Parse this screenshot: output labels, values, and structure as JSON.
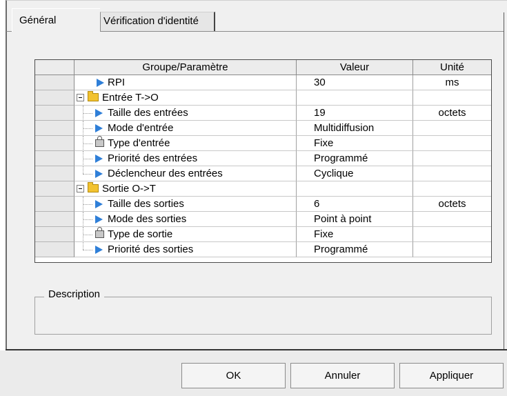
{
  "tabs": {
    "general": "Général",
    "identity": "Vérification d'identité"
  },
  "grid": {
    "headers": {
      "group": "Groupe/Paramètre",
      "value": "Valeur",
      "unit": "Unité"
    },
    "rows": [
      {
        "name": "RPI",
        "value": "30",
        "unit": "ms",
        "icon": "play-icon"
      },
      {
        "name": "Entrée T->O",
        "value": "",
        "unit": "",
        "icon": "folder-icon"
      },
      {
        "name": "Taille des entrées",
        "value": "19",
        "unit": "octets",
        "icon": "play-icon"
      },
      {
        "name": "Mode d'entrée",
        "value": "Multidiffusion",
        "unit": "",
        "icon": "play-icon"
      },
      {
        "name": "Type d'entrée",
        "value": "Fixe",
        "unit": "",
        "icon": "lock-icon"
      },
      {
        "name": "Priorité des entrées",
        "value": "Programmé",
        "unit": "",
        "icon": "play-icon"
      },
      {
        "name": "Déclencheur des entrées",
        "value": "Cyclique",
        "unit": "",
        "icon": "play-icon"
      },
      {
        "name": "Sortie O->T",
        "value": "",
        "unit": "",
        "icon": "folder-icon"
      },
      {
        "name": "Taille des sorties",
        "value": "6",
        "unit": "octets",
        "icon": "play-icon"
      },
      {
        "name": "Mode des sorties",
        "value": "Point à point",
        "unit": "",
        "icon": "play-icon"
      },
      {
        "name": "Type de sortie",
        "value": "Fixe",
        "unit": "",
        "icon": "lock-icon"
      },
      {
        "name": "Priorité des sorties",
        "value": "Programmé",
        "unit": "",
        "icon": "play-icon"
      }
    ]
  },
  "description": {
    "label": "Description"
  },
  "buttons": {
    "ok": "OK",
    "cancel": "Annuler",
    "apply": "Appliquer"
  }
}
